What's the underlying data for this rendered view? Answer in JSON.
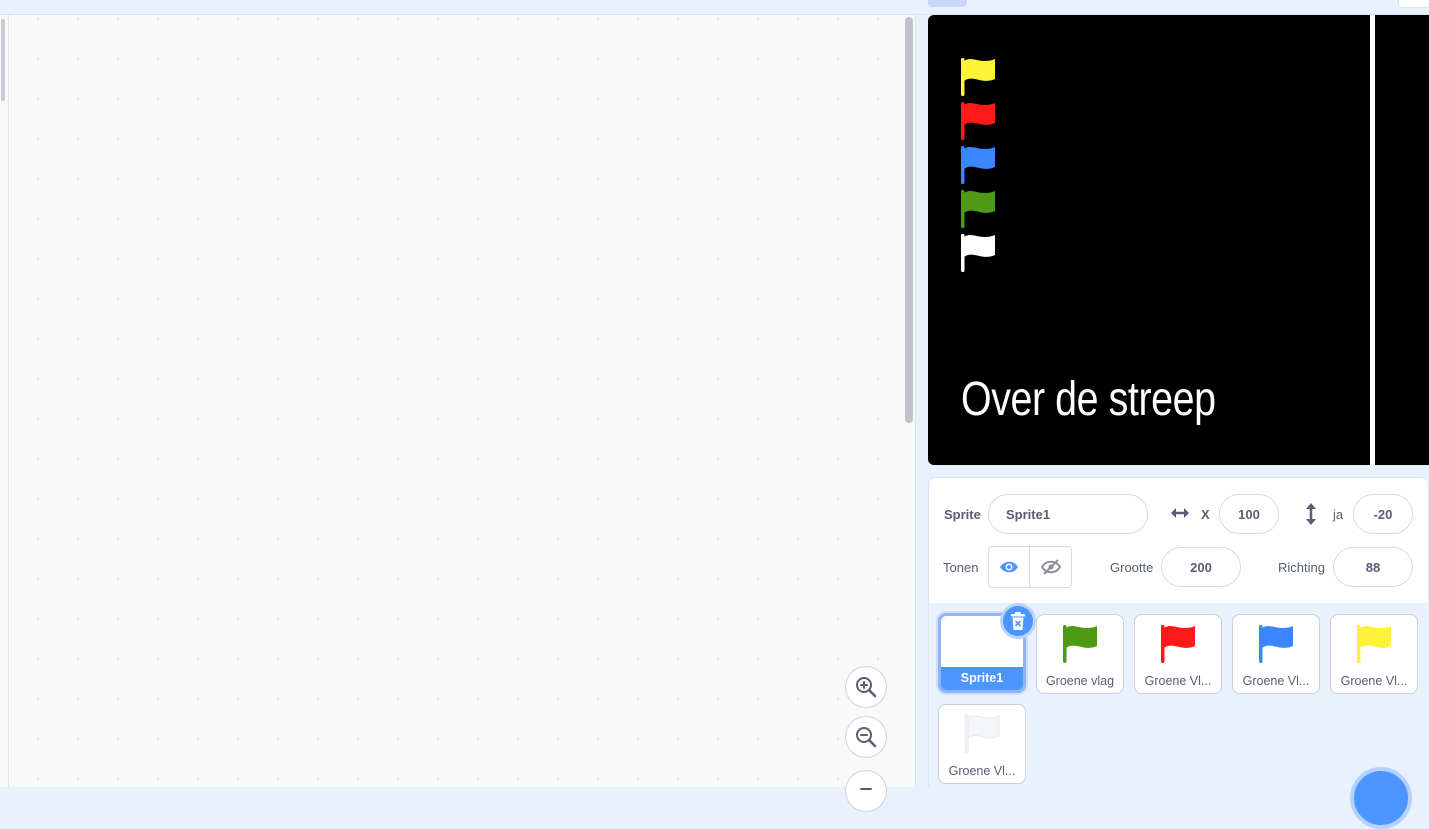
{
  "stage": {
    "title_text": "Over de streep",
    "flags": [
      {
        "icon": "yellow-flag-icon",
        "color": "#fff23a"
      },
      {
        "icon": "red-flag-icon",
        "color": "#ff1a1a"
      },
      {
        "icon": "blue-flag-icon",
        "color": "#3b86ff"
      },
      {
        "icon": "green-flag-icon",
        "color": "#4e9a14"
      },
      {
        "icon": "white-flag-icon",
        "color": "#ffffff"
      }
    ]
  },
  "sprite_info": {
    "sprite_label": "Sprite",
    "sprite_name": "Sprite1",
    "x_label": "X",
    "x_value": "100",
    "y_label": "ja",
    "y_value": "-20",
    "show_label": "Tonen",
    "size_label": "Grootte",
    "size_value": "200",
    "direction_label": "Richting",
    "direction_value": "88"
  },
  "sprites": [
    {
      "name": "Sprite1",
      "selected": true,
      "flag_color": null
    },
    {
      "name": "Groene vlag",
      "selected": false,
      "flag_color": "#4e9a14"
    },
    {
      "name": "Groene Vl...",
      "selected": false,
      "flag_color": "#ff1a1a"
    },
    {
      "name": "Groene Vl...",
      "selected": false,
      "flag_color": "#3b86ff"
    },
    {
      "name": "Groene Vl...",
      "selected": false,
      "flag_color": "#fff23a"
    },
    {
      "name": "Groene Vl...",
      "selected": false,
      "flag_color": "#ffffff"
    }
  ],
  "colors": {
    "accent": "#4c97ff",
    "stage_bg": "#000000"
  }
}
